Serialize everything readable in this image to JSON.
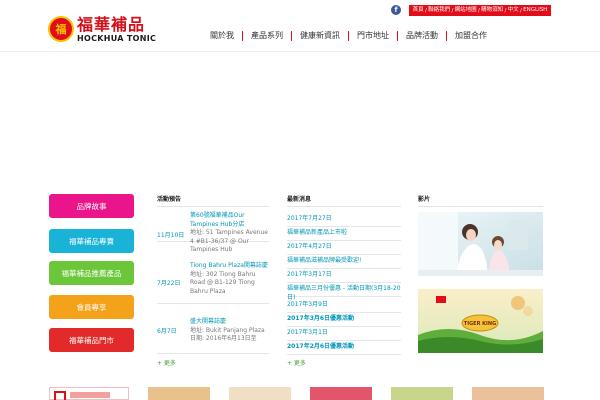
{
  "header": {
    "logo_cn": "福華補品",
    "logo_en": "HOCKHUA TONIC",
    "logo_emblem": "福",
    "facebook_label": "f",
    "languages": [
      "首頁",
      "聯絡我們",
      "網站地圖",
      "購物須知",
      "中文",
      "ENGLISH"
    ],
    "nav": [
      "關於我",
      "產品系列",
      "健康新資訊",
      "門市地址",
      "品牌活動",
      "加盟合作"
    ]
  },
  "categories": [
    {
      "label": "品牌故事",
      "color": "#ea158a"
    },
    {
      "label": "福華補品專賣",
      "color": "#1ab3d8"
    },
    {
      "label": "福華補品推薦產品",
      "color": "#6cc63a"
    },
    {
      "label": "會員專享",
      "color": "#f4a21a"
    },
    {
      "label": "福華補品門市",
      "color": "#e22a2a"
    }
  ],
  "events": {
    "title": "活動預告",
    "items": [
      {
        "date": "11月10日",
        "title": "第60號福華補品Our Tampines Hub分店",
        "address": "地址: 51 Tampines Avenue 4 #B1-36/37 @ Our Tampines Hub"
      },
      {
        "date": "7月22日",
        "title": "Tiong Bahru Plaza開幕誌慶",
        "address": "地址: 302 Tiong Bahru Road @ B1-129 Tiong Bahru Plaza"
      },
      {
        "date": "6月7日",
        "title": "盛大開幕誌慶",
        "address": "地址: Bukit Panjang Plaza 日期: 2016年6月13日至"
      }
    ],
    "more": "+ 更多"
  },
  "news": {
    "title": "最新消息",
    "items": [
      {
        "text": "2017年7月27日",
        "bold": false
      },
      {
        "text": "福華補品新產品上市啦",
        "bold": false
      },
      {
        "text": "2017年4月27日",
        "bold": false
      },
      {
        "text": "福華補品滋補品牌最受歡迎!",
        "bold": false
      },
      {
        "text": "2017年3月17日",
        "bold": false
      },
      {
        "text": "福華補品三月份優惠 - 活動日期(3月18-20日)",
        "bold": false
      },
      {
        "text": "2017年3月9日",
        "bold": false
      },
      {
        "text": "2017年3月6日優惠活動",
        "bold": true
      },
      {
        "text": "2017年3月1日",
        "bold": false
      },
      {
        "text": "2017年2月6日優惠活動",
        "bold": true
      }
    ],
    "more": "+ 更多"
  },
  "video": {
    "title": "影片",
    "banner_text": "TIGER KING"
  },
  "colors": {
    "brand_red": "#e30d1a",
    "link_blue": "#0097b8",
    "more_green": "#4a9f2e"
  }
}
